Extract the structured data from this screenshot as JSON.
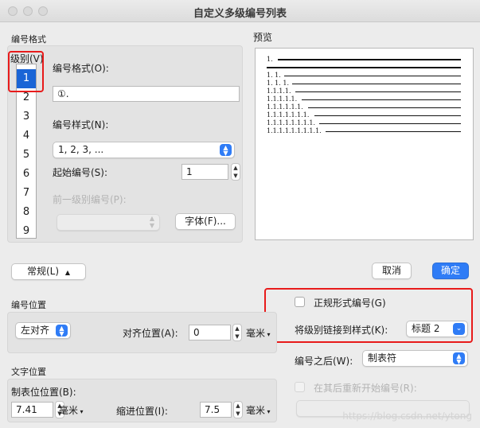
{
  "window": {
    "title": "自定义多级编号列表"
  },
  "numbering_format": {
    "section": "编号格式",
    "level_label": "级别(V)",
    "levels": [
      "1",
      "2",
      "3",
      "4",
      "5",
      "6",
      "7",
      "8",
      "9"
    ],
    "selected_level": "1",
    "format_label": "编号格式(O):",
    "format_value": "①.",
    "style_label": "编号样式(N):",
    "style_value": "1, 2, 3, ...",
    "start_label": "起始编号(S):",
    "start_value": "1",
    "prev_level_label": "前一级别编号(P):",
    "font_button": "字体(F)..."
  },
  "preview": {
    "label": "预览",
    "lines": [
      "1.",
      "1. 1.",
      "1. 1. 1.",
      "1.1.1.1.",
      "1.1.1.1.1.",
      "1.1.1.1.1.1.",
      "1.1.1.1.1.1.1.",
      "1.1.1.1.1.1.1.1.",
      "1.1.1.1.1.1.1.1.1."
    ]
  },
  "mode_button": "常规(L)",
  "cancel_button": "取消",
  "ok_button": "确定",
  "legal_style_label": "正规形式编号(G)",
  "link_style_label": "将级别链接到样式(K):",
  "link_style_value": "标题 2",
  "number_position": {
    "section": "编号位置",
    "align_value": "左对齐",
    "align_pos_label": "对齐位置(A):",
    "align_pos_value": "0",
    "unit": "毫米"
  },
  "follow_label": "编号之后(W):",
  "follow_value": "制表符",
  "restart_label": "在其后重新开始编号(R):",
  "text_position": {
    "section": "文字位置",
    "tab_label": "制表位位置(B):",
    "tab_value": "7.41",
    "indent_label": "缩进位置(I):",
    "indent_value": "7.5",
    "unit": "毫米"
  },
  "watermark": "https://blog.csdn.net/ytong"
}
